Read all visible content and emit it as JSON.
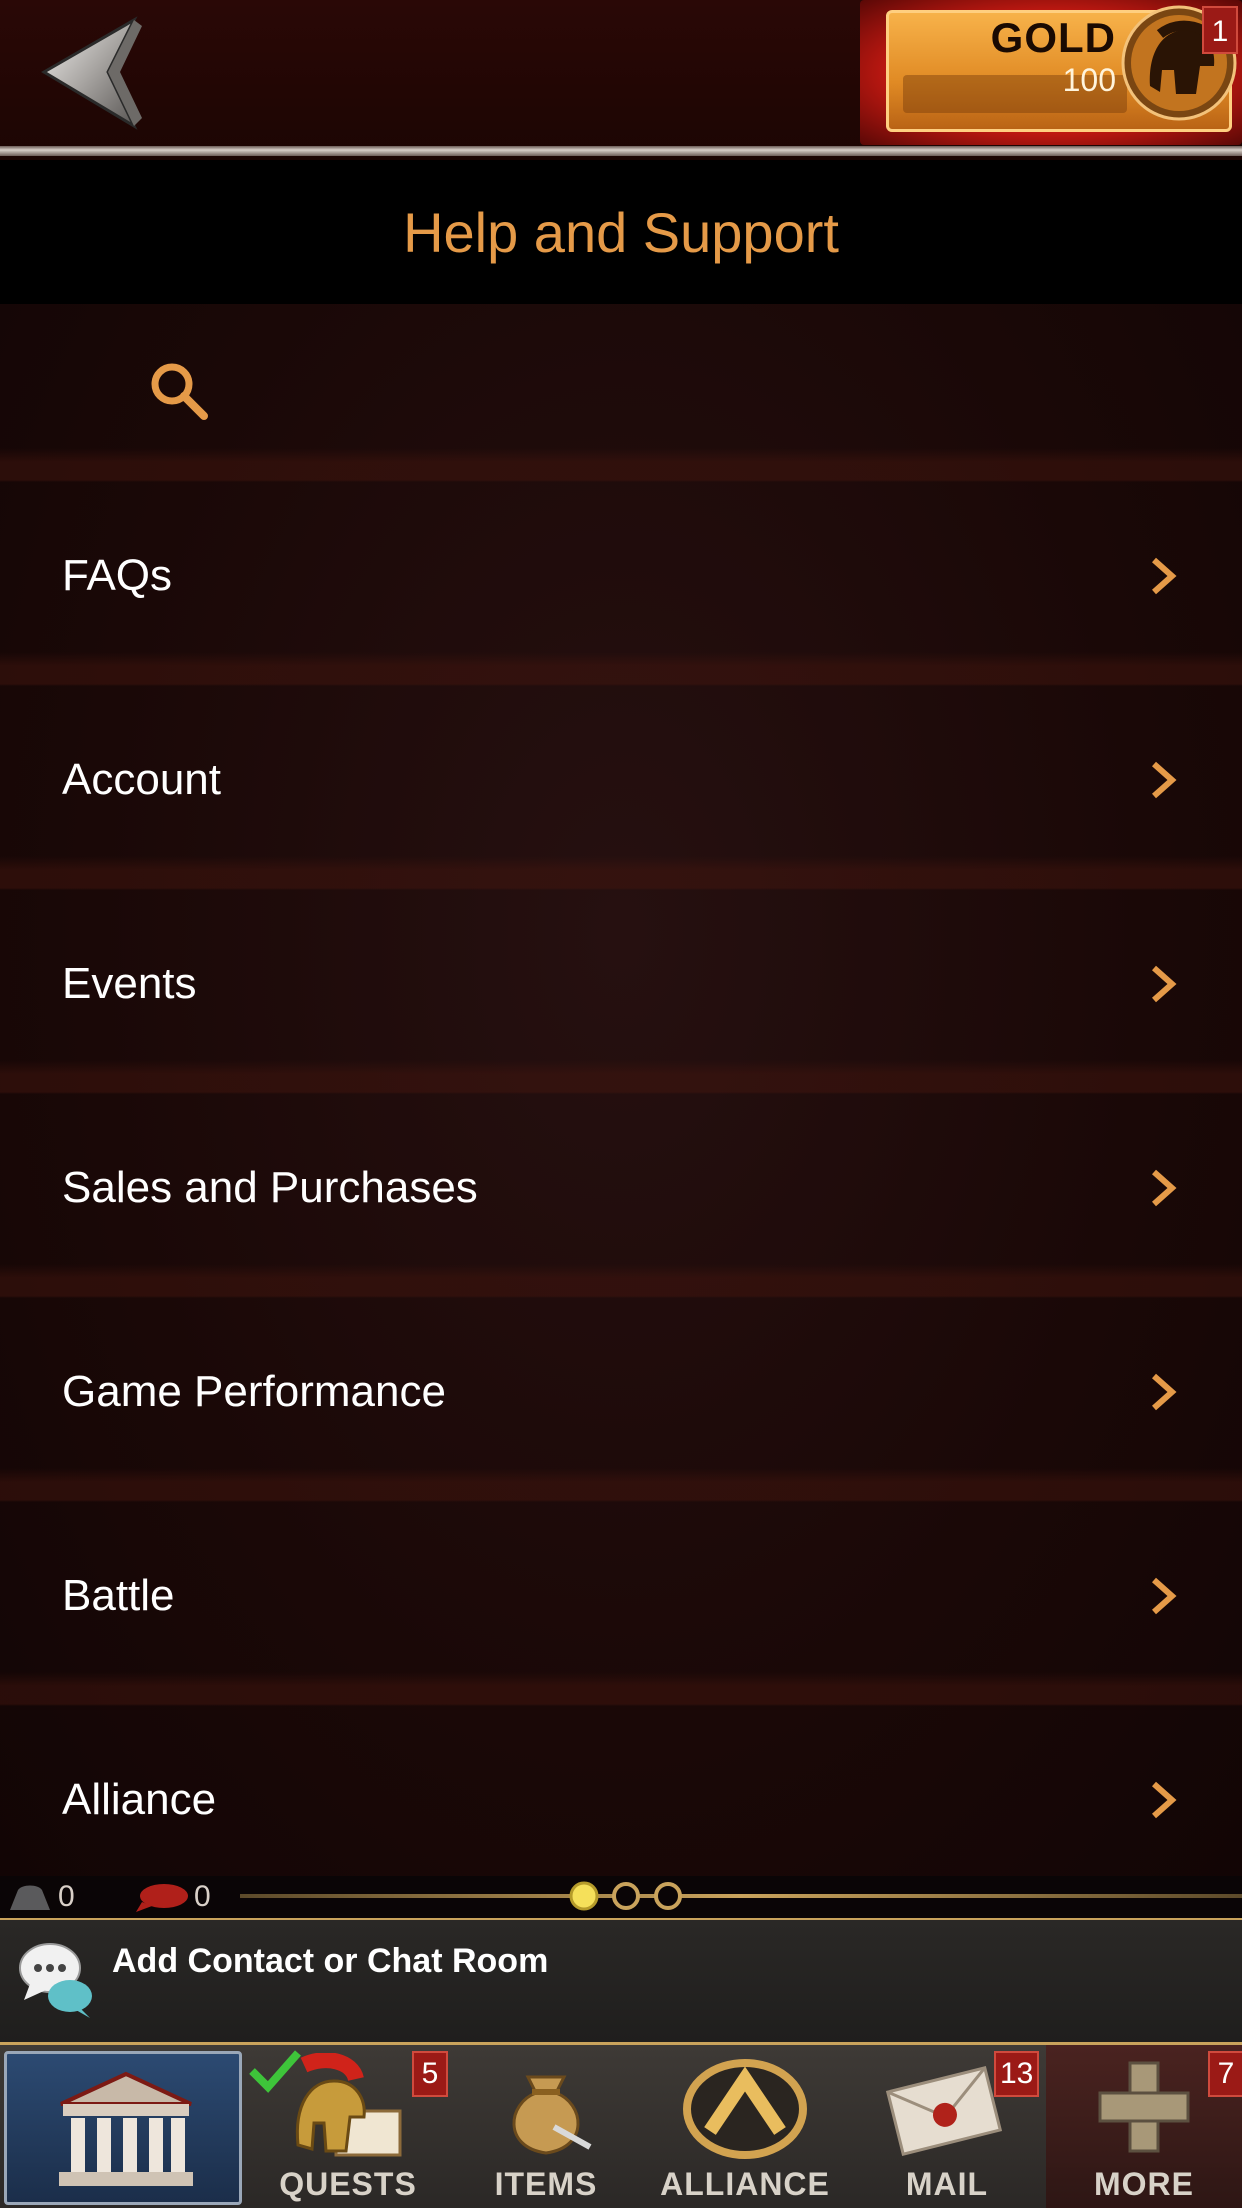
{
  "header": {
    "currency_label": "GOLD",
    "currency_value": "100",
    "currency_badge": "1"
  },
  "page_title": "Help and Support",
  "search": {
    "placeholder": ""
  },
  "menu": {
    "items": [
      {
        "label": "FAQs"
      },
      {
        "label": "Account"
      },
      {
        "label": "Events"
      },
      {
        "label": "Sales and Purchases"
      },
      {
        "label": "Game Performance"
      },
      {
        "label": "Battle"
      },
      {
        "label": "Alliance"
      }
    ]
  },
  "status": {
    "contacts_count": "0",
    "messages_count": "0",
    "page_indicator": {
      "current": 1,
      "total": 3
    }
  },
  "chat": {
    "label": "Add Contact or Chat Room"
  },
  "nav": {
    "quests": {
      "label": "QUESTS",
      "badge": "5"
    },
    "items": {
      "label": "ITEMS"
    },
    "alliance": {
      "label": "ALLIANCE"
    },
    "mail": {
      "label": "MAIL",
      "badge": "13"
    },
    "more": {
      "label": "MORE",
      "badge": "7"
    }
  },
  "colors": {
    "accent": "#e59a48",
    "badge": "#9b1a16",
    "background": "#1a0807"
  }
}
